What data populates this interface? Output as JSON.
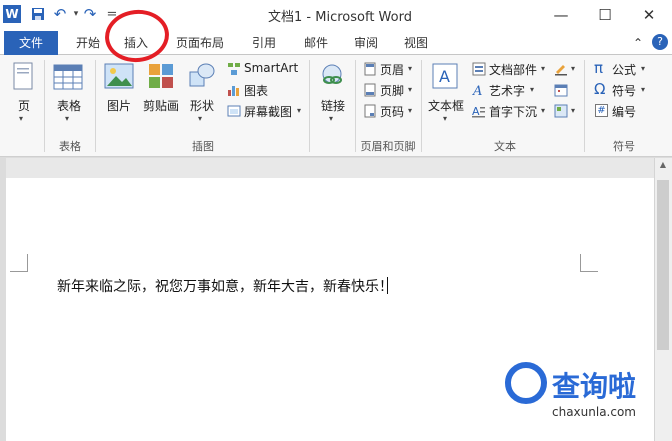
{
  "window": {
    "title": "文档1 - Microsoft Word",
    "minimize_glyph": "—",
    "maximize_glyph": "☐",
    "close_glyph": "✕"
  },
  "quick_access": {
    "app_icon_letter": "W",
    "undo_glyph": "↶",
    "redo_glyph": "↷",
    "dropdown_glyph": "▾",
    "overflow_glyph": "="
  },
  "tabs": {
    "file": "文件",
    "items": [
      "开始",
      "插入",
      "页面布局",
      "引用",
      "邮件",
      "审阅",
      "视图"
    ]
  },
  "ribbon_right": {
    "collapse_glyph": "⌃",
    "help_glyph": "?"
  },
  "ribbon": {
    "pages": {
      "label": "页",
      "group": ""
    },
    "tables": {
      "label": "表格",
      "group": "表格"
    },
    "illustrations": {
      "group": "插图",
      "picture": "图片",
      "clipart": "剪贴画",
      "shapes": "形状",
      "smartart": "SmartArt",
      "chart": "图表",
      "screenshot": "屏幕截图"
    },
    "links": {
      "label": "链接",
      "group": ""
    },
    "header_footer": {
      "group": "页眉和页脚",
      "header": "页眉",
      "footer": "页脚",
      "page_number": "页码"
    },
    "text": {
      "group": "文本",
      "textbox": "文本框",
      "quick_parts": "文档部件",
      "wordart": "艺术字",
      "dropcap": "首字下沉"
    },
    "symbols": {
      "group": "符号",
      "equation": "公式",
      "symbol": "符号",
      "number": "编号",
      "equation_glyph": "π",
      "symbol_glyph": "Ω",
      "number_glyph": "#"
    }
  },
  "document": {
    "text": "新年来临之际，祝您万事如意，新年大吉，新春快乐！"
  },
  "colors": {
    "file_tab": "#2a63b8",
    "annotation": "#e41e25",
    "watermark": "#2a6ad6"
  },
  "watermark": {
    "text": "查询啦",
    "url": "chaxunla.com"
  }
}
